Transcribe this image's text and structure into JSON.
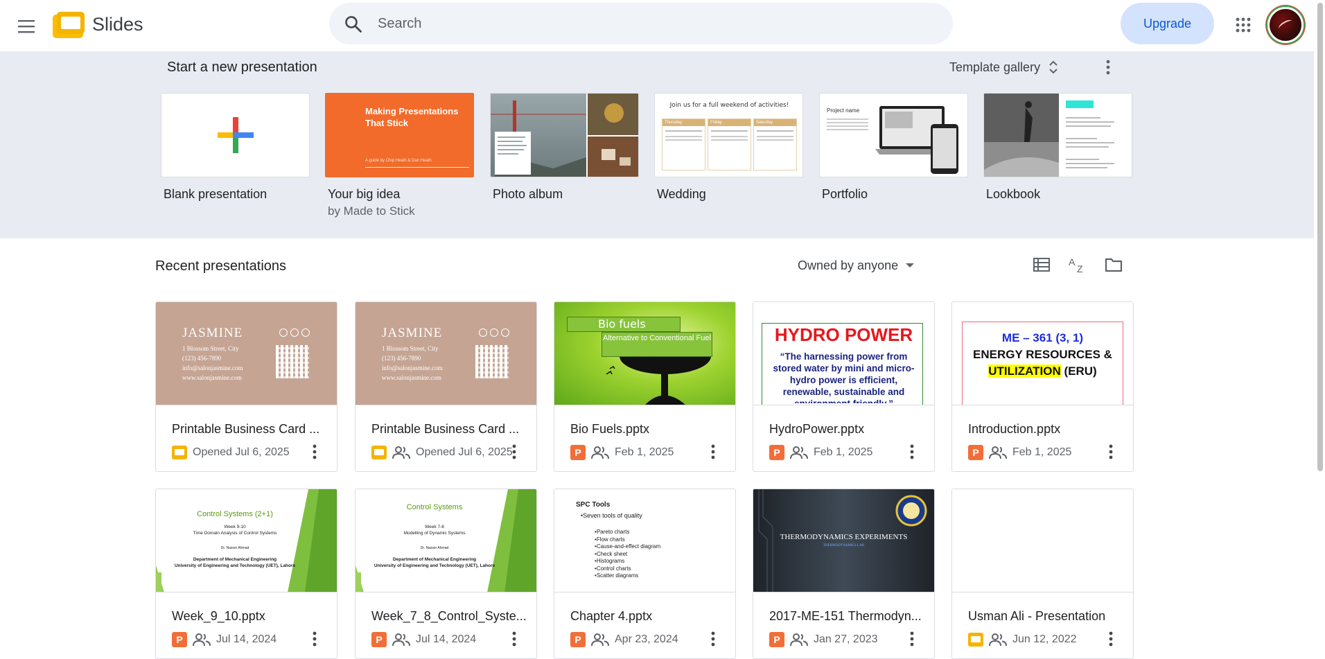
{
  "header": {
    "app_name": "Slides",
    "search_placeholder": "Search",
    "upgrade_label": "Upgrade"
  },
  "templates": {
    "heading": "Start a new presentation",
    "gallery_label": "Template gallery",
    "items": [
      {
        "name": "Blank presentation",
        "sub": ""
      },
      {
        "name": "Your big idea",
        "sub": "by Made to Stick",
        "thumb_title": "Making Presentations That Stick",
        "thumb_caption": "A guide by Chip Heath & Dan Heath"
      },
      {
        "name": "Photo album",
        "sub": ""
      },
      {
        "name": "Wedding",
        "sub": "",
        "thumb_title": "Join us for a full weekend of activities!",
        "thumb_cols": [
          "Thursday",
          "Friday",
          "Saturday"
        ]
      },
      {
        "name": "Portfolio",
        "sub": "",
        "thumb_title": "Project name"
      },
      {
        "name": "Lookbook",
        "sub": ""
      }
    ]
  },
  "recent": {
    "title": "Recent presentations",
    "owner_filter": "Owned by anyone",
    "files": [
      {
        "title": "Printable Business Card ...",
        "meta": "Opened Jul 6, 2025",
        "type": "slides",
        "shared": false,
        "thumb": {
          "name": "JASMINE",
          "lines": [
            "1 Blossom Street, City",
            "(123) 456-7890",
            "info@salonjasmine.com",
            "www.salonjasmine.com"
          ]
        }
      },
      {
        "title": "Printable Business Card ...",
        "meta": "Opened Jul 6, 2025",
        "type": "slides",
        "shared": true,
        "thumb": {
          "name": "JASMINE",
          "lines": [
            "1 Blossom Street, City",
            "(123) 456-7890",
            "info@salonjasmine.com",
            "www.salonjasmine.com"
          ]
        }
      },
      {
        "title": "Bio Fuels.pptx",
        "meta": "Feb 1, 2025",
        "type": "pptx",
        "shared": true,
        "thumb": {
          "title": "Bio fuels",
          "subtitle": "Alternative to Conventional Fuel"
        }
      },
      {
        "title": "HydroPower.pptx",
        "meta": "Feb 1, 2025",
        "type": "pptx",
        "shared": true,
        "thumb": {
          "title": "HYDRO POWER",
          "body": "“The harnessing power from stored water by mini and micro-hydro power is efficient, renewable, sustainable and environment friendly.”"
        }
      },
      {
        "title": "Introduction.pptx",
        "meta": "Feb 1, 2025",
        "type": "pptx",
        "shared": true,
        "thumb": {
          "line1": "ME – 361 (3, 1)",
          "line2": "ENERGY RESOURCES &",
          "line3a": "UTILIZATION",
          "line3b": " (ERU)"
        }
      },
      {
        "title": "Week_9_10.pptx",
        "meta": "Jul 14, 2024",
        "type": "pptx",
        "shared": true,
        "thumb": {
          "title": "Control Systems (2+1)",
          "week": "Week 9-10",
          "topic": "Time Domain Analysis of Control Systems",
          "author": "Dr. Nasser Ahmad",
          "dept": "Department of Mechanical Engineering",
          "uni": "University of Engineering and Technology (UET), Lahore"
        }
      },
      {
        "title": "Week_7_8_Control_Syste...",
        "meta": "Jul 14, 2024",
        "type": "pptx",
        "shared": true,
        "thumb": {
          "title": "Control Systems",
          "week": "Week 7-8",
          "topic": "Modelling of Dynamic Systems",
          "author": "Dr. Nasser Ahmad",
          "dept": "Department of Mechanical Engineering",
          "uni": "University of Engineering and Technology (UET), Lahore"
        }
      },
      {
        "title": "Chapter 4.pptx",
        "meta": "Apr 23, 2024",
        "type": "pptx",
        "shared": true,
        "thumb": {
          "title": "SPC Tools",
          "lead": "•Seven tools of quality",
          "items": [
            "Pareto charts",
            "Flow charts",
            "Cause-and-effect diagram",
            "Check sheet",
            "Histograms",
            "Control charts",
            "Scatter diagrams"
          ]
        }
      },
      {
        "title": "2017-ME-151 Thermodyn...",
        "meta": "Jan 27, 2023",
        "type": "pptx",
        "shared": true,
        "thumb": {
          "title": "THERMODYNAMICS EXPERIMENTS",
          "subtitle": "THERMODYNAMICS LAB"
        }
      },
      {
        "title": "Usman Ali - Presentation",
        "meta": "Jun 12, 2022",
        "type": "slides",
        "shared": true,
        "thumb": {}
      }
    ]
  }
}
